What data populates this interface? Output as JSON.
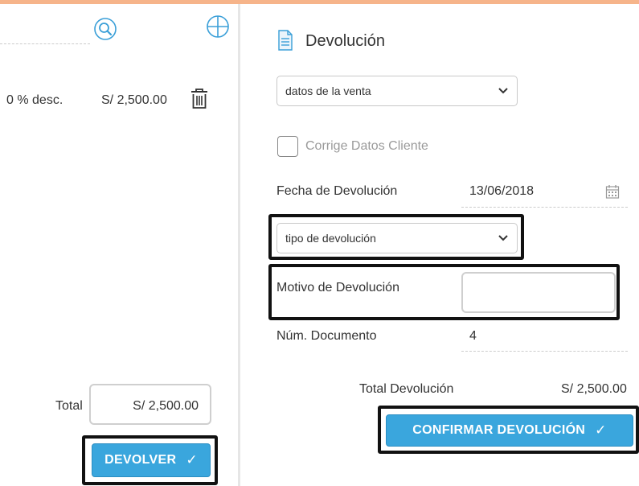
{
  "left": {
    "line_discount": "0 % desc.",
    "line_price": "S/ 2,500.00",
    "total_label": "Total",
    "total_value": "S/ 2,500.00",
    "devolver_label": "DEVOLVER",
    "check_glyph": "✓",
    "icons": [
      "search-icon",
      "add-icon",
      "trash-icon"
    ]
  },
  "right": {
    "title": "Devolución",
    "venta_select": {
      "selected": "datos de la venta"
    },
    "corrige_label": "Corrige Datos Cliente",
    "corrige_checked": false,
    "fecha_label": "Fecha de Devolución",
    "fecha_value": "13/06/2018",
    "tipo_select": {
      "selected": "tipo de devolución"
    },
    "motivo_label": "Motivo de Devolución",
    "motivo_value": "",
    "num_doc_label": "Núm. Documento",
    "num_doc_value": "4",
    "total_dev_label": "Total Devolución",
    "total_dev_value": "S/ 2,500.00",
    "confirmar_label": "CONFIRMAR DEVOLUCIÓN",
    "icons": [
      "document-icon",
      "calendar-icon",
      "chevron-down-icon"
    ]
  },
  "colors": {
    "accent_top": "#f6b48a",
    "button_blue": "#3aa6dd",
    "icon_blue": "#3a9fd8",
    "highlight_frame": "#111111"
  }
}
